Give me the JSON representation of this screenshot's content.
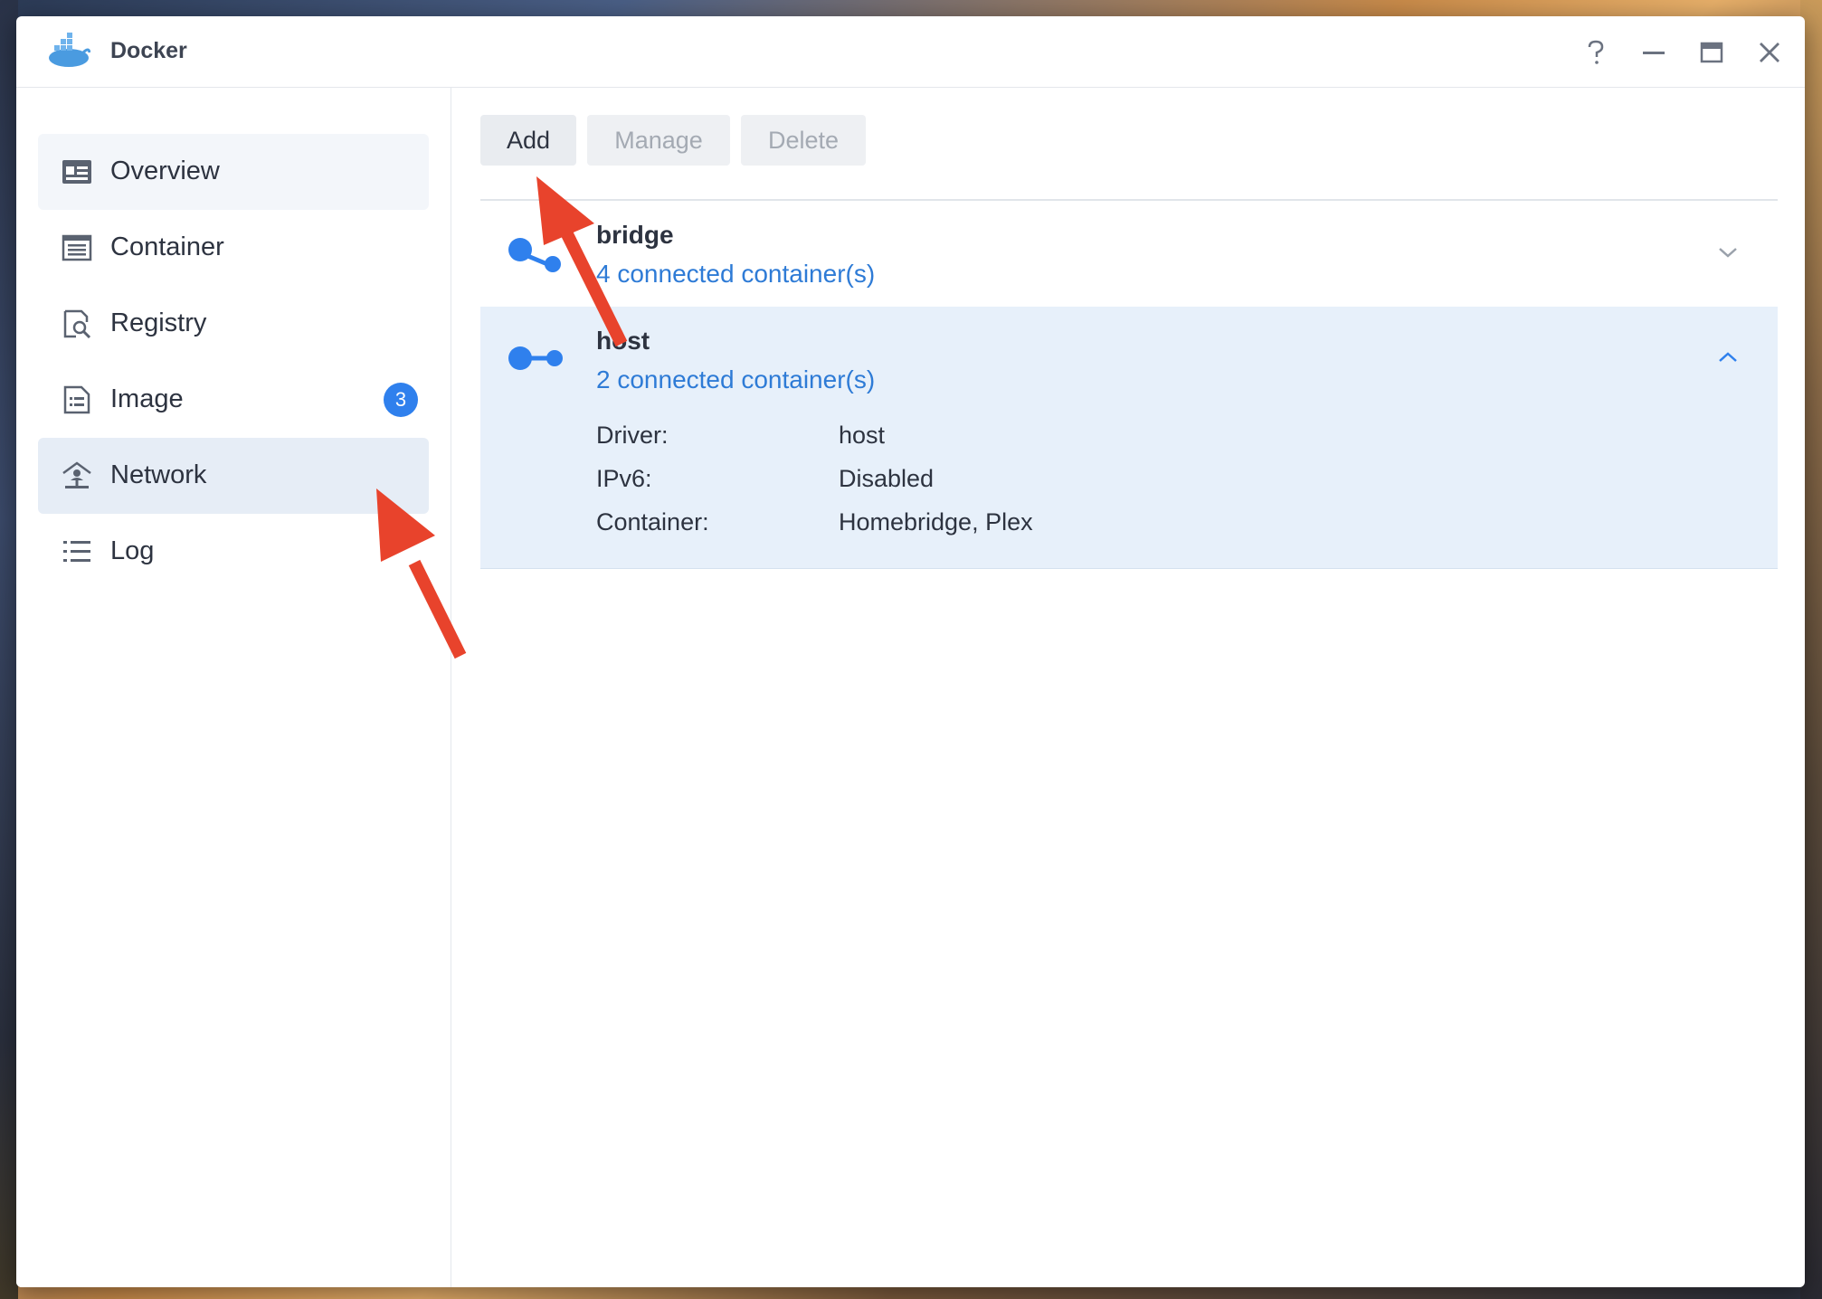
{
  "window": {
    "title": "Docker"
  },
  "sidebar": {
    "items": [
      {
        "label": "Overview",
        "icon": "overview-icon"
      },
      {
        "label": "Container",
        "icon": "container-icon"
      },
      {
        "label": "Registry",
        "icon": "registry-icon"
      },
      {
        "label": "Image",
        "icon": "image-icon",
        "badge": "3"
      },
      {
        "label": "Network",
        "icon": "network-icon",
        "active": true
      },
      {
        "label": "Log",
        "icon": "log-icon"
      }
    ]
  },
  "toolbar": {
    "add_label": "Add",
    "manage_label": "Manage",
    "delete_label": "Delete"
  },
  "networks": [
    {
      "name": "bridge",
      "connected": "4 connected container(s)",
      "expanded": false
    },
    {
      "name": "host",
      "connected": "2 connected container(s)",
      "expanded": true,
      "details": [
        {
          "key": "Driver:",
          "value": "host"
        },
        {
          "key": "IPv6:",
          "value": "Disabled"
        },
        {
          "key": "Container:",
          "value": "Homebridge, Plex"
        }
      ]
    }
  ],
  "colors": {
    "accent": "#2f80ed",
    "link": "#2e7bd6",
    "annotation_arrow": "#e8432c"
  }
}
